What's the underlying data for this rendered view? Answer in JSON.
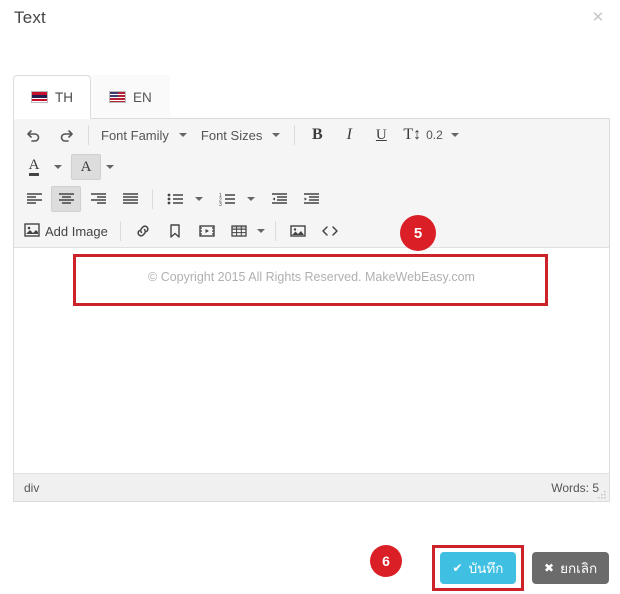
{
  "modal": {
    "title": "Text",
    "close_icon": "close-icon"
  },
  "tabs": [
    {
      "label": "TH",
      "flag": "thailand-flag-icon",
      "active": true
    },
    {
      "label": "EN",
      "flag": "usa-flag-icon",
      "active": false
    }
  ],
  "toolbar": {
    "row1": {
      "undo": "undo-icon",
      "redo": "redo-icon",
      "font_family_label": "Font Family",
      "font_sizes_label": "Font Sizes",
      "bold": "B",
      "italic": "I",
      "underline": "U",
      "line_height_icon": "line-height-icon",
      "line_height_value": "0.2"
    },
    "row2": {
      "text_color": "text-color-icon",
      "background_color": "background-color-icon"
    },
    "row3": {
      "align_left": "align-left-icon",
      "align_center": "align-center-icon",
      "align_right": "align-right-icon",
      "align_justify": "align-justify-icon",
      "bullet_list": "bullet-list-icon",
      "numbered_list": "numbered-list-icon",
      "outdent": "outdent-icon",
      "indent": "indent-icon"
    },
    "row4": {
      "add_image_label": "Add Image",
      "insert_link": "link-icon",
      "anchor": "bookmark-icon",
      "media": "media-icon",
      "table": "table-icon",
      "image": "image-icon",
      "source_code": "code-icon"
    }
  },
  "content": {
    "body_text": "© Copyright 2015 All Rights Reserved. MakeWebEasy.com"
  },
  "statusbar": {
    "path": "div",
    "word_count": "Words: 5",
    "resize_grip": "resize-grip-icon"
  },
  "badges": {
    "step5": "5",
    "step6": "6"
  },
  "footer": {
    "save_label": "บันทึก",
    "save_icon": "check-icon",
    "cancel_label": "ยกเลิก",
    "cancel_icon": "x-icon"
  },
  "colors": {
    "accent_red": "#cc2229",
    "badge_red": "#da1f26",
    "save_cyan": "#3fc0e3",
    "cancel_gray": "#6b6b6b"
  }
}
